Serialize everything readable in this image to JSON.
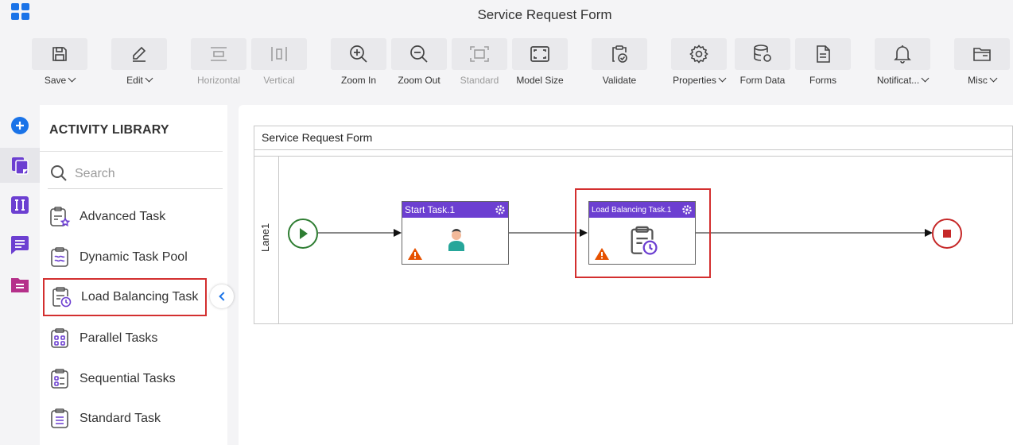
{
  "app": {
    "title": "Service Request Form"
  },
  "toolbar": {
    "save": "Save",
    "edit": "Edit",
    "horizontal": "Horizontal",
    "vertical": "Vertical",
    "zoom_in": "Zoom In",
    "zoom_out": "Zoom Out",
    "standard": "Standard",
    "model_size": "Model Size",
    "validate": "Validate",
    "properties": "Properties",
    "form_data": "Form Data",
    "forms": "Forms",
    "notifications": "Notificat...",
    "misc": "Misc"
  },
  "library": {
    "title": "ACTIVITY LIBRARY",
    "search_placeholder": "Search",
    "items": [
      {
        "label": "Advanced Task",
        "icon": "advanced-task-icon"
      },
      {
        "label": "Dynamic Task Pool",
        "icon": "dynamic-task-pool-icon"
      },
      {
        "label": "Load Balancing Task",
        "icon": "load-balancing-task-icon",
        "highlighted": true
      },
      {
        "label": "Parallel Tasks",
        "icon": "parallel-tasks-icon"
      },
      {
        "label": "Sequential Tasks",
        "icon": "sequential-tasks-icon"
      },
      {
        "label": "Standard Task",
        "icon": "standard-task-icon"
      }
    ]
  },
  "canvas": {
    "pool_title": "Service Request Form",
    "lane_label": "Lane1",
    "tasks": [
      {
        "title": "Start Task.1",
        "icon": "user-icon",
        "warning": true
      },
      {
        "title": "Load Balancing Task.1",
        "icon": "load-balancing-task-icon",
        "warning": true,
        "selected": true
      }
    ]
  },
  "colors": {
    "accent": "#1a73e8",
    "task_header": "#6c3fd1",
    "highlight": "#d32f2f",
    "start_event": "#2e7d32",
    "end_event": "#c62828",
    "warning": "#e65100"
  }
}
